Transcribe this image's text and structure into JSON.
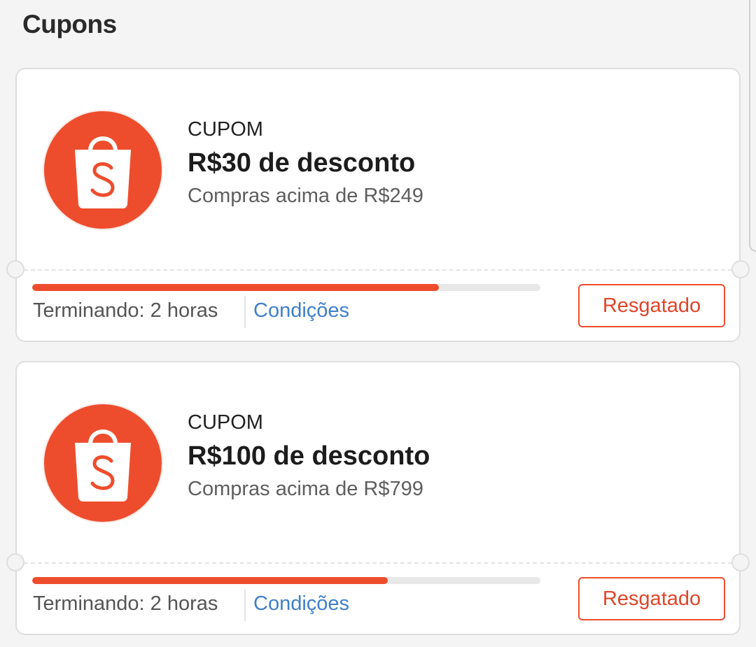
{
  "page": {
    "title": "Cupons"
  },
  "colors": {
    "brand": "#ee4d2d",
    "link": "#3f7fc9",
    "progress_track": "#e8e8e8"
  },
  "coupons": [
    {
      "logo_icon": "shopee-bag-icon",
      "type_label": "CUPOM",
      "amount": "R$30 de desconto",
      "min_spend": "Compras acima de R$249",
      "usage_fraction": 0.8,
      "expiry": "Terminando: 2 horas",
      "conditions_label": "Condições",
      "button_label": "Resgatado"
    },
    {
      "logo_icon": "shopee-bag-icon",
      "type_label": "CUPOM",
      "amount": "R$100 de desconto",
      "min_spend": "Compras acima de R$799",
      "usage_fraction": 0.7,
      "expiry": "Terminando: 2 horas",
      "conditions_label": "Condições",
      "button_label": "Resgatado"
    }
  ]
}
